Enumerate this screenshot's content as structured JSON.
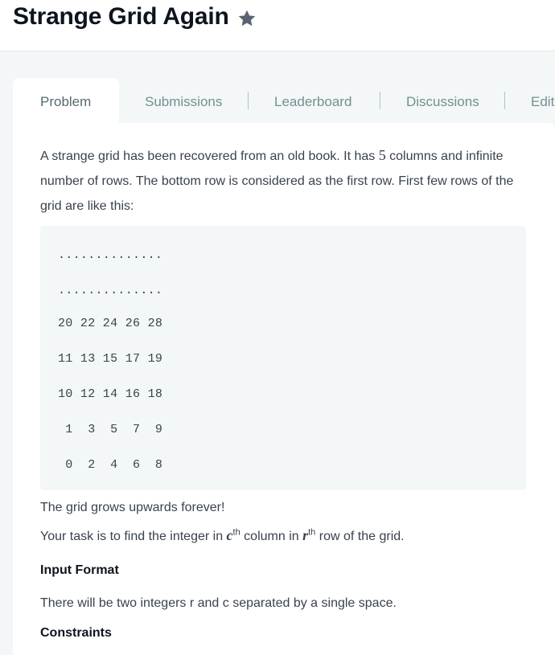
{
  "header": {
    "title": "Strange Grid Again",
    "star_icon": "star-icon"
  },
  "tabs": [
    {
      "label": "Problem",
      "active": true
    },
    {
      "label": "Submissions",
      "active": false
    },
    {
      "label": "Leaderboard",
      "active": false
    },
    {
      "label": "Discussions",
      "active": false
    },
    {
      "label": "Edit",
      "active": false
    }
  ],
  "content": {
    "intro_a": "A strange grid has been recovered from an old book. It has ",
    "intro_num": "5",
    "intro_b": " columns and infinite number of rows. The bottom row is considered as the first row. First few rows of the grid are like this:",
    "grid_rows": [
      "..............",
      "..............",
      "20 22 24 26 28",
      "11 13 15 17 19",
      "10 12 14 16 18",
      " 1  3  5  7  9",
      " 0  2  4  6  8"
    ],
    "grows": "The grid grows upwards forever!",
    "task_a": "Your task is to find the integer in ",
    "task_c": "c",
    "task_th1": "th",
    "task_b": " column in ",
    "task_r": "r",
    "task_th2": "th",
    "task_c2": " row of the grid.",
    "input_heading": "Input Format",
    "input_text": "There will be two integers r and c separated by a single space.",
    "constraints_heading": "Constraints"
  },
  "colors": {
    "accent_text": "#0e141e",
    "muted_tab": "#738f93",
    "code_bg": "#f3f7f7"
  }
}
